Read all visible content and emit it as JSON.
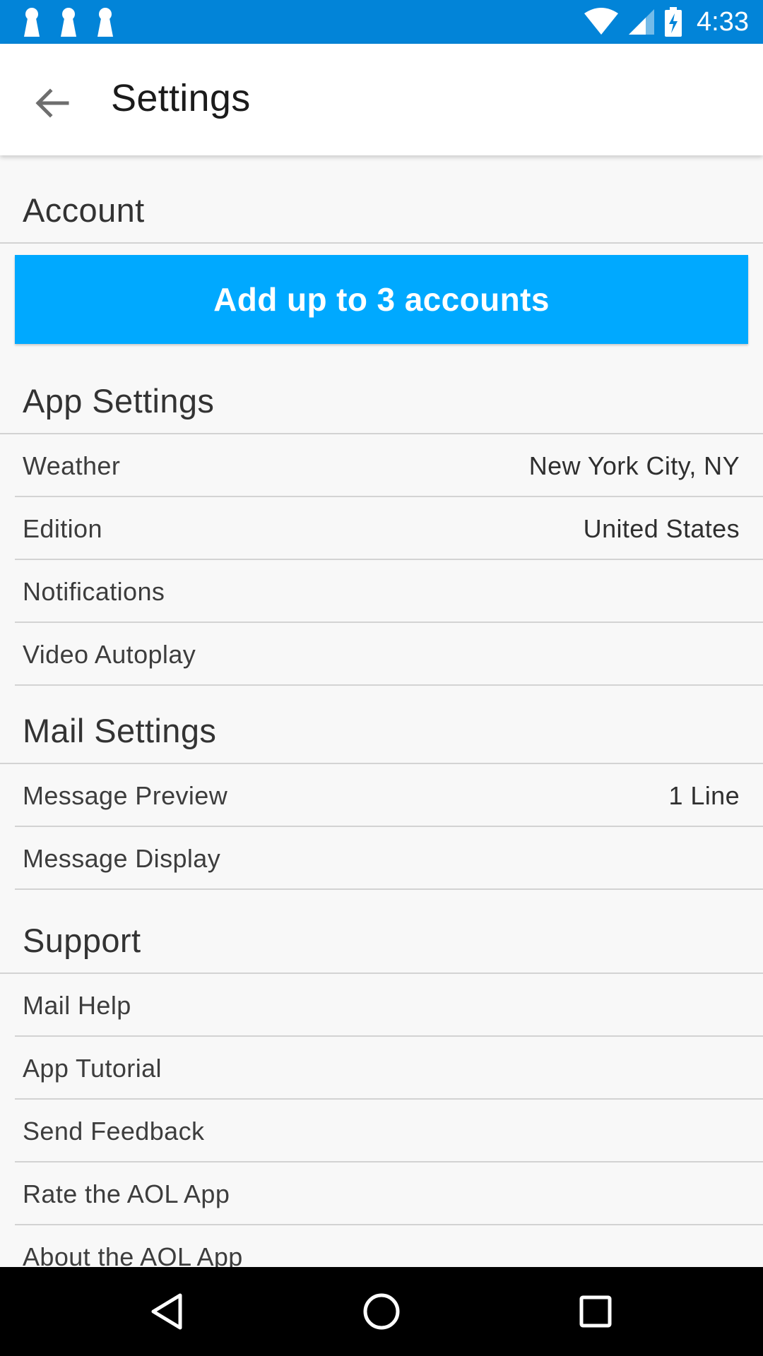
{
  "status_bar": {
    "time": "4:33",
    "notification_icons": [
      "notification-icon",
      "notification-icon",
      "notification-icon"
    ],
    "right_icons": [
      "wifi-icon",
      "cell-signal-icon",
      "battery-charging-icon"
    ]
  },
  "app_bar": {
    "title": "Settings",
    "back_icon": "arrow-back-icon"
  },
  "sections": {
    "account": {
      "title": "Account",
      "add_button_label": "Add up to 3 accounts"
    },
    "app_settings": {
      "title": "App Settings",
      "items": [
        {
          "label": "Weather",
          "value": "New York City, NY"
        },
        {
          "label": "Edition",
          "value": "United States"
        },
        {
          "label": "Notifications",
          "value": ""
        },
        {
          "label": "Video Autoplay",
          "value": ""
        }
      ]
    },
    "mail_settings": {
      "title": "Mail Settings",
      "items": [
        {
          "label": "Message Preview",
          "value": "1 Line"
        },
        {
          "label": "Message Display",
          "value": ""
        }
      ]
    },
    "support": {
      "title": "Support",
      "items": [
        {
          "label": "Mail Help"
        },
        {
          "label": "App Tutorial"
        },
        {
          "label": "Send Feedback"
        },
        {
          "label": "Rate the AOL App"
        },
        {
          "label": "About the AOL App"
        }
      ]
    }
  },
  "nav_bar": {
    "icons": [
      "nav-back-icon",
      "nav-home-icon",
      "nav-recents-icon"
    ]
  },
  "colors": {
    "status_bar": "#0284d8",
    "accent_button": "#00a9ff",
    "background": "#f8f8f8",
    "divider": "#d3d3d3"
  }
}
